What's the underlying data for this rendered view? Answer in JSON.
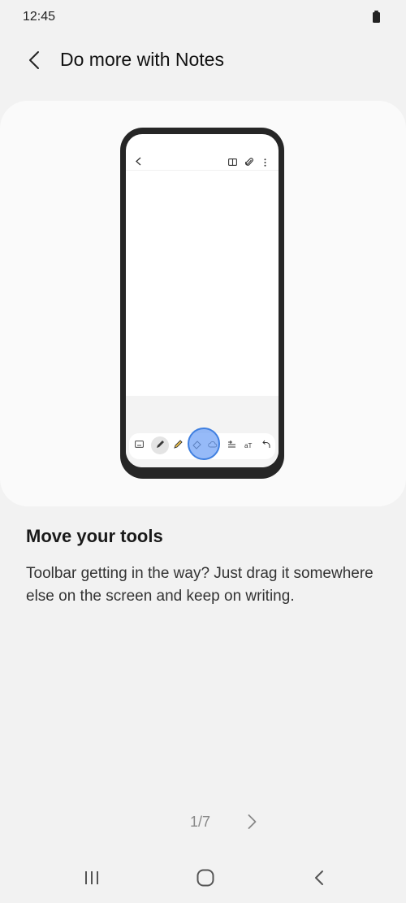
{
  "status_bar": {
    "time": "12:45",
    "battery_icon": "battery-full-icon"
  },
  "header": {
    "back_icon": "arrow-back-icon",
    "title": "Do more with Notes"
  },
  "illustration": {
    "top_bar_icons": [
      "chevron-left-icon",
      "book-icon",
      "paperclip-icon",
      "more-vert-icon"
    ],
    "toolbar_icons": [
      "keyboard-icon",
      "pen-icon",
      "highlighter-icon",
      "eraser-icon",
      "cloud-shape-icon",
      "text-style-icon",
      "text-size-icon",
      "undo-icon"
    ],
    "accent_color": "#3f7fe0"
  },
  "tip": {
    "title": "Move your tools",
    "body": "Toolbar getting in the way? Just drag it somewhere else on the screen and keep on writing."
  },
  "pager": {
    "indicator": "1/7",
    "next_icon": "chevron-right-icon"
  },
  "nav_bar": {
    "icons": [
      "recents-icon",
      "home-icon",
      "back-icon"
    ]
  }
}
